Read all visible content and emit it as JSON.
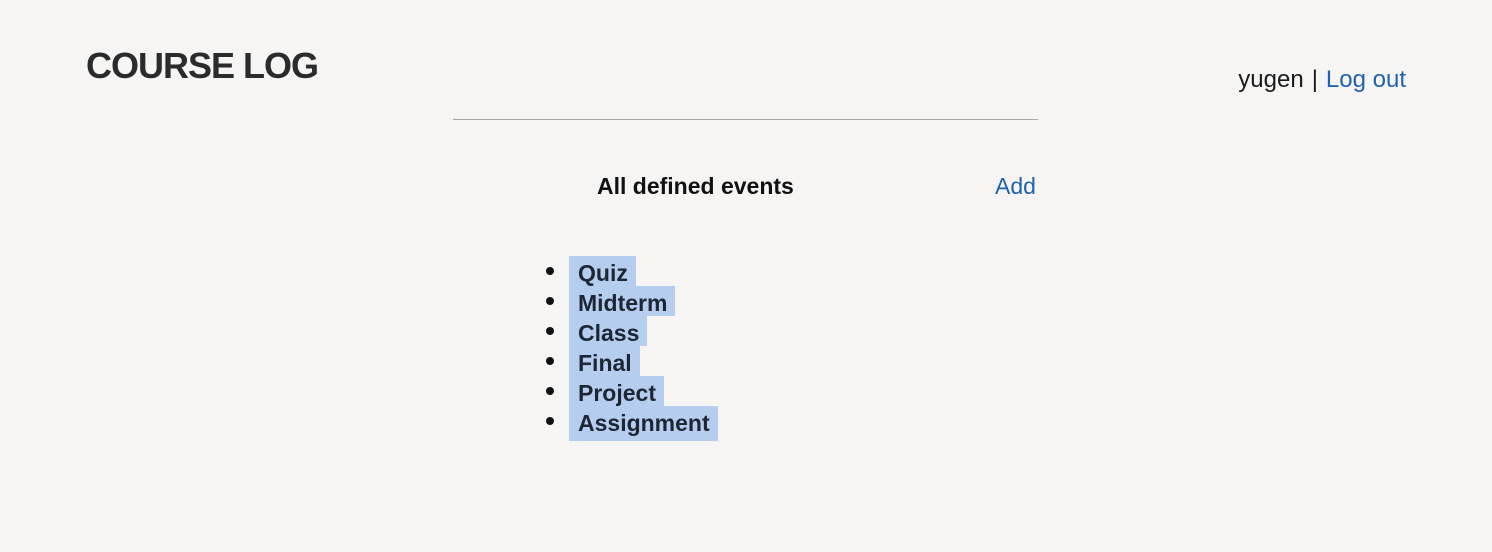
{
  "header": {
    "brand": "COURSE LOG",
    "username": "yugen",
    "separator": "|",
    "logout_label": "Log out"
  },
  "main": {
    "title": "All defined events",
    "add_label": "Add",
    "events": [
      "Quiz",
      "Midterm",
      "Class",
      "Final",
      "Project",
      "Assignment"
    ]
  },
  "colors": {
    "background": "#f7f5f3",
    "link": "#1f63ad",
    "selection_highlight": "#b5cdef",
    "divider": "#a6a6a6"
  }
}
